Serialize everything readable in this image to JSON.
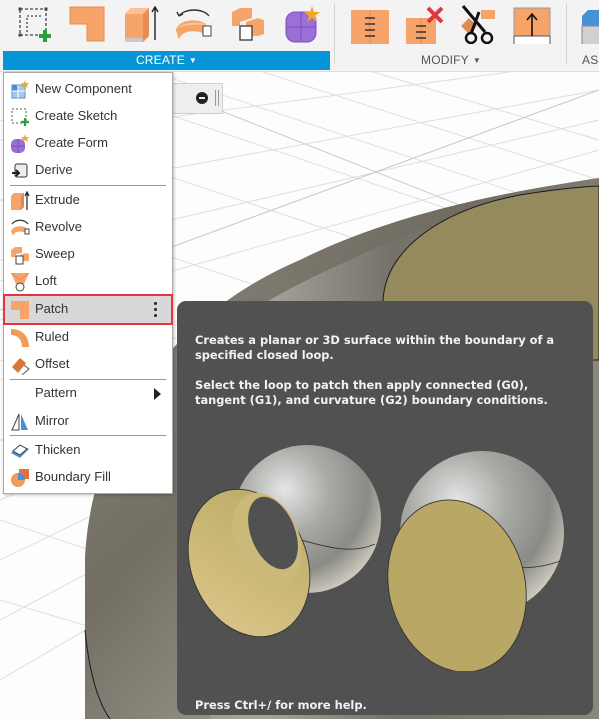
{
  "toolbar": {
    "groups": [
      {
        "label": "CREATE",
        "caret": "▼",
        "active": true,
        "tools": [
          "create-sketch-icon",
          "patch-icon",
          "extrude-icon",
          "revolve-icon",
          "sweep-icon",
          "create-form-icon"
        ]
      },
      {
        "label": "MODIFY",
        "caret": "▼",
        "active": false,
        "tools": [
          "split-face-icon",
          "stitch-icon",
          "trim-icon",
          "extend-icon"
        ]
      },
      {
        "label": "AS",
        "caret": "",
        "active": false,
        "tools": [
          "assemble-icon"
        ]
      }
    ],
    "accent_color": "#0696d7"
  },
  "menu": {
    "title": "CREATE",
    "items": [
      {
        "label": "New Component",
        "icon": "new-component-icon"
      },
      {
        "label": "Create Sketch",
        "icon": "create-sketch-icon"
      },
      {
        "label": "Create Form",
        "icon": "create-form-icon"
      },
      {
        "label": "Derive",
        "icon": "derive-icon"
      },
      {
        "label": "Extrude",
        "icon": "extrude-icon"
      },
      {
        "label": "Revolve",
        "icon": "revolve-icon"
      },
      {
        "label": "Sweep",
        "icon": "sweep-icon"
      },
      {
        "label": "Loft",
        "icon": "loft-icon"
      },
      {
        "label": "Patch",
        "icon": "patch-icon",
        "highlighted": true,
        "options_icon": "more-options-icon"
      },
      {
        "label": "Ruled",
        "icon": "ruled-icon"
      },
      {
        "label": "Offset",
        "icon": "offset-icon"
      },
      {
        "label": "Pattern",
        "icon": "",
        "submenu": true
      },
      {
        "label": "Mirror",
        "icon": "mirror-icon"
      },
      {
        "label": "Thicken",
        "icon": "thicken-icon"
      },
      {
        "label": "Boundary Fill",
        "icon": "boundary-fill-icon"
      }
    ],
    "highlight_color": "#e8343d"
  },
  "tooltip": {
    "description": "Creates a planar or 3D surface within the boundary of a specified closed loop.",
    "detail": "Select the loop to patch then apply connected (G0), tangent (G1), and curvature (G2) boundary conditions.",
    "help": "Press Ctrl+/ for more help.",
    "illustration": "patch-example-illustration"
  }
}
